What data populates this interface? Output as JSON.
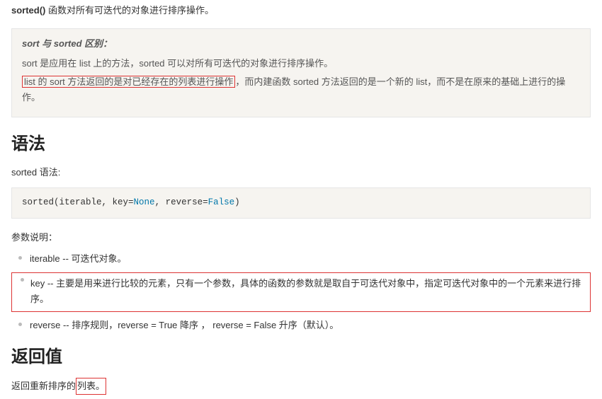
{
  "intro": {
    "func": "sorted()",
    "rest": " 函数对所有可迭代的对象进行排序操作。"
  },
  "note": {
    "title": "sort 与 sorted 区别：",
    "line1": "sort 是应用在 list 上的方法，sorted 可以对所有可迭代的对象进行排序操作。",
    "line2_boxed": "list 的 sort 方法返回的是对已经存在的列表进行操作",
    "line2_rest": "，而内建函数 sorted 方法返回的是一个新的 list，而不是在原来的基础上进行的操作。"
  },
  "syntax": {
    "heading": "语法",
    "desc": "sorted 语法:",
    "code_fn": "sorted",
    "code_open": "(iterable, key=",
    "code_none": "None",
    "code_mid": ", reverse=",
    "code_false": "False",
    "code_close": ")"
  },
  "params": {
    "label": "参数说明：",
    "iterable": "iterable -- 可迭代对象。",
    "key": "key -- 主要是用来进行比较的元素，只有一个参数，具体的函数的参数就是取自于可迭代对象中，指定可迭代对象中的一个元素来进行排序。",
    "reverse": "reverse -- 排序规则，reverse = True 降序 ， reverse = False 升序（默认）。"
  },
  "return": {
    "heading": "返回值",
    "prefix": "返回重新排序的",
    "boxed": "列表。"
  }
}
